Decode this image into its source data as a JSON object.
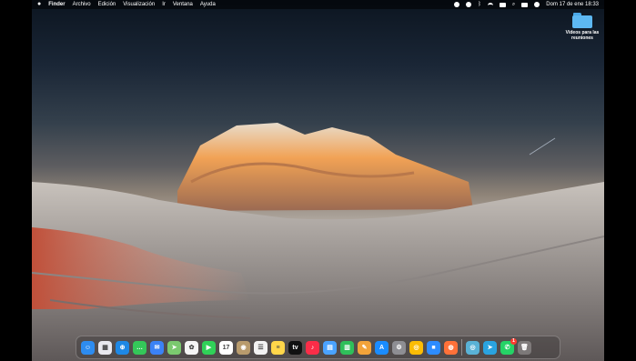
{
  "menubar": {
    "apple_icon": "apple-icon",
    "items": [
      "Finder",
      "Archivo",
      "Edición",
      "Visualización",
      "Ir",
      "Ventana",
      "Ayuda"
    ],
    "status_icons": [
      "screen-record-icon",
      "play-icon",
      "bluetooth-icon",
      "wifi-icon",
      "battery-icon",
      "search-icon",
      "control-center-icon",
      "siri-icon"
    ],
    "clock": "Dom 17 de ene  18:33"
  },
  "desktop": {
    "icon_label": "Vídeos para las reuniones",
    "icon_name": "folder-icon"
  },
  "dock": {
    "apps": [
      {
        "name": "finder",
        "label": "☺",
        "color": "#2d8cf0"
      },
      {
        "name": "launchpad",
        "label": "▦",
        "color": "#e8e8ee"
      },
      {
        "name": "safari",
        "label": "⊕",
        "color": "#1e88e5"
      },
      {
        "name": "messages",
        "label": "…",
        "color": "#34c759"
      },
      {
        "name": "mail",
        "label": "✉",
        "color": "#3b82f6"
      },
      {
        "name": "maps",
        "label": "➤",
        "color": "#7bc96f"
      },
      {
        "name": "photos",
        "label": "✿",
        "color": "#f5f5f5"
      },
      {
        "name": "facetime",
        "label": "▶",
        "color": "#30d158"
      },
      {
        "name": "calendar",
        "label": "17",
        "color": "#ffffff"
      },
      {
        "name": "contacts",
        "label": "◉",
        "color": "#b89b6d"
      },
      {
        "name": "reminders",
        "label": "☰",
        "color": "#f2f2f2"
      },
      {
        "name": "notes",
        "label": "≡",
        "color": "#ffd64a"
      },
      {
        "name": "tv",
        "label": "tv",
        "color": "#111111"
      },
      {
        "name": "music",
        "label": "♪",
        "color": "#fa2d48"
      },
      {
        "name": "keynote",
        "label": "▤",
        "color": "#4aa3ff"
      },
      {
        "name": "numbers",
        "label": "▥",
        "color": "#2fbf5a"
      },
      {
        "name": "pages",
        "label": "✎",
        "color": "#f2a33a"
      },
      {
        "name": "app-store",
        "label": "A",
        "color": "#1a8cff"
      },
      {
        "name": "system-preferences",
        "label": "⚙",
        "color": "#8e8e93"
      },
      {
        "name": "chrome",
        "label": "◎",
        "color": "#fbbc05"
      },
      {
        "name": "zoom",
        "label": "■",
        "color": "#2d8cff"
      },
      {
        "name": "firefox",
        "label": "◍",
        "color": "#ff7139"
      }
    ],
    "apps_right": [
      {
        "name": "chrome-canary",
        "label": "◎",
        "color": "#5ab2d6"
      },
      {
        "name": "telegram",
        "label": "➤",
        "color": "#2aa3e0"
      },
      {
        "name": "whatsapp",
        "label": "✆",
        "color": "#25d366",
        "badge": "1"
      }
    ],
    "trash_icon": "trash-icon"
  }
}
